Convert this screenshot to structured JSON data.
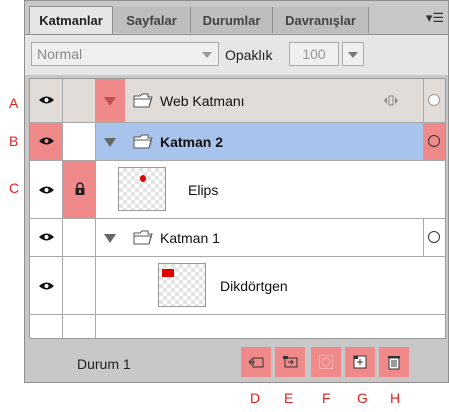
{
  "callouts": {
    "a": "A",
    "b": "B",
    "c": "C",
    "d": "D",
    "e": "E",
    "f": "F",
    "g": "G",
    "h": "H"
  },
  "tabs": [
    "Katmanlar",
    "Sayfalar",
    "Durumlar",
    "Davranışlar"
  ],
  "active_tab": "Katmanlar",
  "panel_menu_icon": "panel-menu-icon",
  "options": {
    "blend_mode": "Normal",
    "opacity_label": "Opaklık",
    "opacity_value": "100"
  },
  "layers": [
    {
      "name": "Web Katmanı",
      "type": "folder",
      "expanded": true,
      "bold": false,
      "selected": false
    },
    {
      "name": "Katman 2",
      "type": "folder",
      "expanded": true,
      "bold": true,
      "selected": true
    },
    {
      "name": "Elips",
      "type": "object",
      "locked": true
    },
    {
      "name": "Katman 1",
      "type": "folder",
      "expanded": true,
      "bold": false,
      "selected": false
    },
    {
      "name": "Dikdörtgen",
      "type": "object",
      "locked": false
    }
  ],
  "footer": {
    "state": "Durum 1",
    "buttons": [
      "new-sublayer-icon",
      "new-layer-icon",
      "add-mask-icon",
      "new-bitmap-icon",
      "delete-icon"
    ]
  },
  "colors": {
    "highlight": "#f08a8a",
    "selected_row": "#a8c4ec",
    "callout": "#e02020"
  }
}
